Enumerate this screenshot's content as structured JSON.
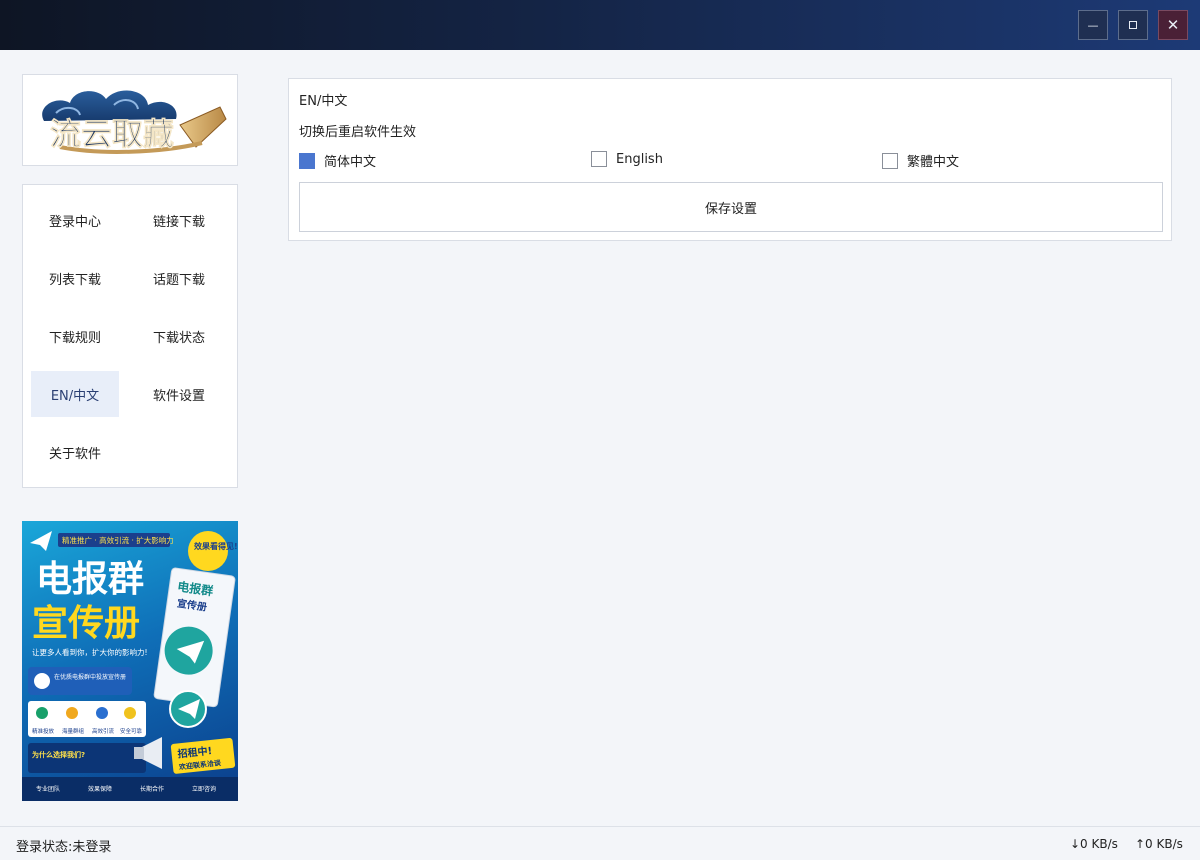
{
  "window": {
    "minimize_glyph": "—",
    "close_glyph": "✕"
  },
  "logo": {
    "text": "流云取藏"
  },
  "nav": {
    "items": [
      {
        "label": "登录中心"
      },
      {
        "label": "链接下载"
      },
      {
        "label": "列表下载"
      },
      {
        "label": "话题下载"
      },
      {
        "label": "下载规则"
      },
      {
        "label": "下载状态"
      },
      {
        "label": "EN/中文",
        "active": true
      },
      {
        "label": "软件设置"
      },
      {
        "label": "关于软件"
      }
    ]
  },
  "ad": {
    "tagline": "精准推广 · 高效引流 · 扩大影响力",
    "badge": "效果看得见!",
    "title_line1": "电报群",
    "title_line2": "宣传册",
    "book_title1": "电报群",
    "book_title2": "宣传册",
    "slogan": "让更多人看到你，扩大你的影响力!",
    "notice": "在优质电报群中投放宣传册",
    "features": [
      "精准投放",
      "海量群组",
      "高效引流",
      "安全可靠"
    ],
    "why": "为什么选择我们?",
    "rent": "招租中!",
    "contact": "欢迎联系洽谈",
    "bottom": [
      "专业团队",
      "效果保障",
      "长期合作",
      "立即咨询"
    ]
  },
  "settings": {
    "title": "EN/中文",
    "hint": "切换后重启软件生效",
    "options": [
      {
        "label": "简体中文",
        "checked": true
      },
      {
        "label": "English",
        "checked": false
      },
      {
        "label": "繁體中文",
        "checked": false
      }
    ],
    "save_label": "保存设置"
  },
  "status": {
    "login": "登录状态:未登录",
    "download": "↓0 KB/s",
    "upload": "↑0 KB/s"
  },
  "colors": {
    "accent": "#4a76cf",
    "title_bar": "#142445"
  }
}
